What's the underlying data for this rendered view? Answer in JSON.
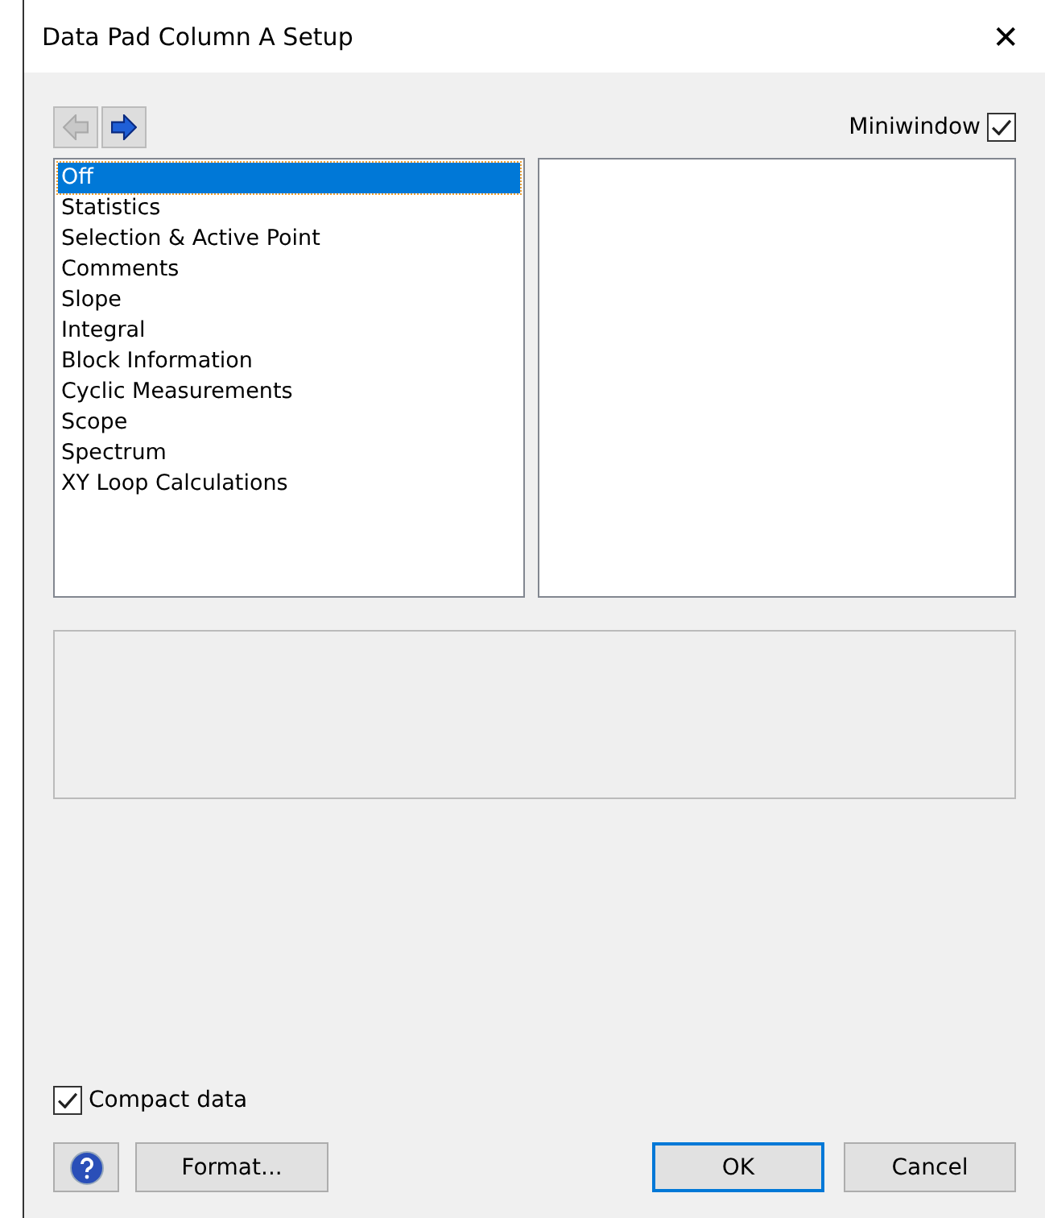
{
  "window": {
    "title": "Data Pad Column A Setup",
    "close": "✕"
  },
  "nav": [
    {
      "kind": "back",
      "disabled": true
    },
    {
      "kind": "forward",
      "disabled": false
    }
  ],
  "miniwindow": {
    "label": "Miniwindow",
    "checked": true
  },
  "list": [
    {
      "label": "Off",
      "selected": true
    },
    {
      "label": "Statistics",
      "selected": false
    },
    {
      "label": "Selection & Active Point",
      "selected": false
    },
    {
      "label": "Comments",
      "selected": false
    },
    {
      "label": "Slope",
      "selected": false
    },
    {
      "label": "Integral",
      "selected": false
    },
    {
      "label": "Block Information",
      "selected": false
    },
    {
      "label": "Cyclic Measurements",
      "selected": false
    },
    {
      "label": "Scope",
      "selected": false
    },
    {
      "label": "Spectrum",
      "selected": false
    },
    {
      "label": "XY Loop Calculations",
      "selected": false
    }
  ],
  "compact_data": {
    "label": "Compact data",
    "checked": true
  },
  "buttons": [
    {
      "label": "Format..."
    },
    {
      "label": "OK",
      "default": true
    },
    {
      "label": "Cancel"
    }
  ]
}
